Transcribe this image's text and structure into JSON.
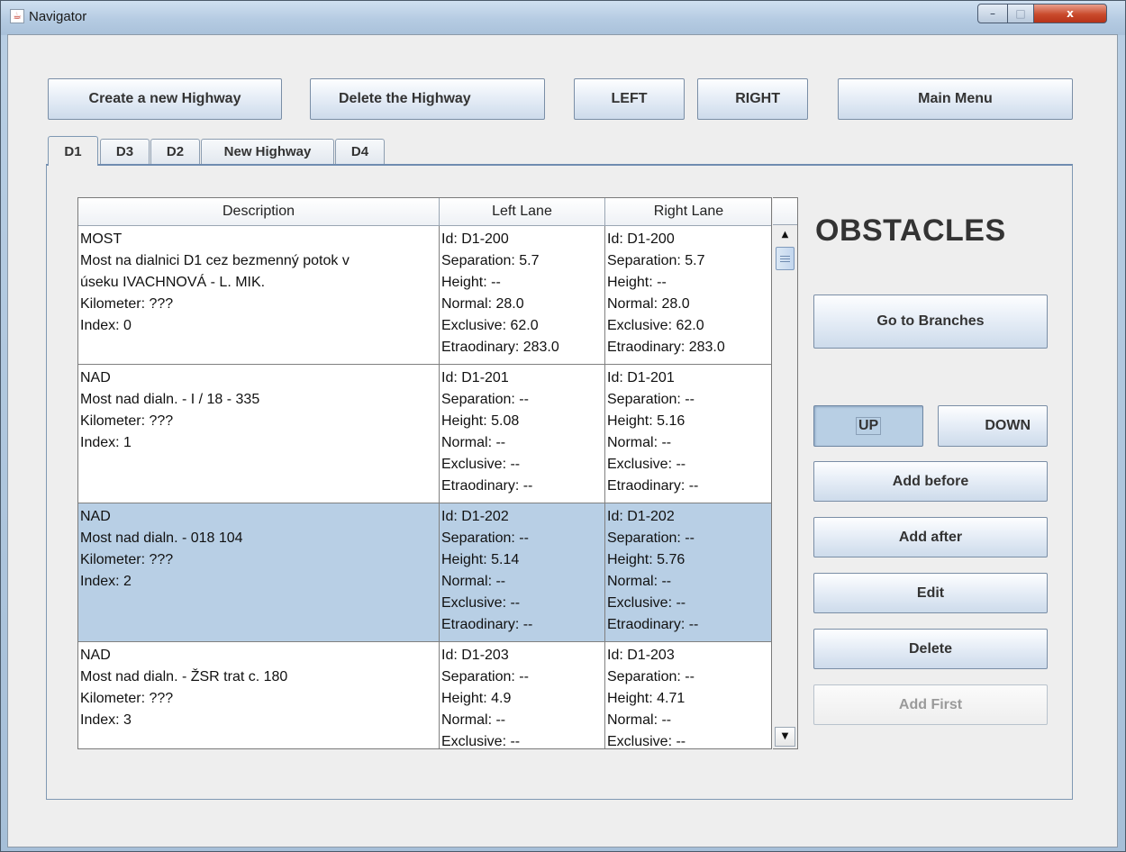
{
  "window": {
    "title": "Navigator",
    "app_icon": "java-cup-icon",
    "controls": {
      "minimize": "–",
      "maximize": "□",
      "close": "x"
    }
  },
  "toolbar": {
    "create_label": "Create a new Highway",
    "delete_label": "Delete the Highway",
    "left_label": "LEFT",
    "right_label": "RIGHT",
    "main_menu_label": "Main Menu"
  },
  "tabs": [
    {
      "label": "D1",
      "active": true
    },
    {
      "label": "D3",
      "active": false
    },
    {
      "label": "D2",
      "active": false
    },
    {
      "label": "New Highway",
      "active": false
    },
    {
      "label": "D4",
      "active": false
    }
  ],
  "table": {
    "columns": [
      "Description",
      "Left Lane",
      "Right Lane"
    ],
    "selected_row": 2,
    "rows": [
      {
        "description": [
          "MOST",
          "Most na dialnici D1 cez bezmenný potok v",
          "úseku IVACHNOVÁ - L. MIK.",
          "Kilometer: ???",
          "Index: 0"
        ],
        "left": [
          "Id: D1-200",
          "Separation: 5.7",
          "Height: --",
          "Normal: 28.0",
          "Exclusive: 62.0",
          "Etraodinary: 283.0"
        ],
        "right": [
          "Id: D1-200",
          "Separation: 5.7",
          "Height: --",
          "Normal: 28.0",
          "Exclusive: 62.0",
          "Etraodinary: 283.0"
        ]
      },
      {
        "description": [
          "NAD",
          "Most nad dialn. - I / 18 - 335",
          "Kilometer: ???",
          "Index: 1"
        ],
        "left": [
          "Id: D1-201",
          "Separation: --",
          "Height: 5.08",
          "Normal: --",
          "Exclusive: --",
          "Etraodinary: --"
        ],
        "right": [
          "Id: D1-201",
          "Separation: --",
          "Height: 5.16",
          "Normal: --",
          "Exclusive: --",
          "Etraodinary: --"
        ]
      },
      {
        "description": [
          "NAD",
          "Most nad dialn. - 018 104",
          "Kilometer: ???",
          "Index: 2"
        ],
        "left": [
          "Id: D1-202",
          "Separation: --",
          "Height: 5.14",
          "Normal: --",
          "Exclusive: --",
          "Etraodinary: --"
        ],
        "right": [
          "Id: D1-202",
          "Separation: --",
          "Height: 5.76",
          "Normal: --",
          "Exclusive: --",
          "Etraodinary: --"
        ]
      },
      {
        "description": [
          "NAD",
          "Most nad dialn. - ŽSR trat c. 180",
          "Kilometer: ???",
          "Index: 3"
        ],
        "left": [
          "Id: D1-203",
          "Separation: --",
          "Height: 4.9",
          "Normal: --",
          "Exclusive: --"
        ],
        "right": [
          "Id: D1-203",
          "Separation: --",
          "Height: 4.71",
          "Normal: --",
          "Exclusive: --"
        ]
      }
    ]
  },
  "side": {
    "heading": "OBSTACLES",
    "go_branches_label": "Go to Branches",
    "up_label": "UP",
    "down_label": "DOWN",
    "add_before_label": "Add before",
    "add_after_label": "Add after",
    "edit_label": "Edit",
    "delete_label": "Delete",
    "add_first_label": "Add First"
  }
}
